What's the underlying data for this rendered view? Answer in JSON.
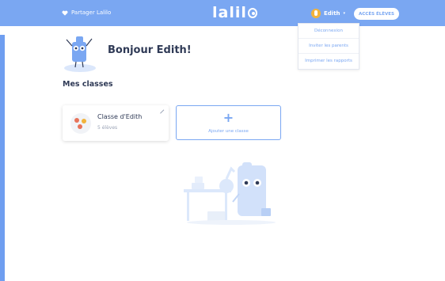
{
  "header": {
    "share_label": "Partager Lalilo",
    "logo_text": "lalil",
    "user_name": "Edith",
    "caret": "▾",
    "student_access_label": "ACCÈS ÉLÈVES"
  },
  "user_menu": {
    "items": [
      {
        "label": "Déconnexion"
      },
      {
        "label": "Inviter les parents"
      },
      {
        "label": "Imprimer les rapports"
      }
    ]
  },
  "main": {
    "greeting": "Bonjour Edith!",
    "section_title": "Mes classes",
    "classes": [
      {
        "name": "Classe d'Edith",
        "students": "5 élèves"
      }
    ],
    "add_class": {
      "icon": "+",
      "label": "Ajouter une classe"
    }
  },
  "colors": {
    "header_bg": "#7aa7f2",
    "accent": "#7aa7f2",
    "text": "#2f3a56"
  },
  "icons": {
    "share": "heart-icon",
    "logo_o": "logo-o-icon",
    "avatar": "user-avatar-icon",
    "edit": "pencil-icon",
    "mascot": "mascot-illustration",
    "empty": "classroom-illustration"
  }
}
